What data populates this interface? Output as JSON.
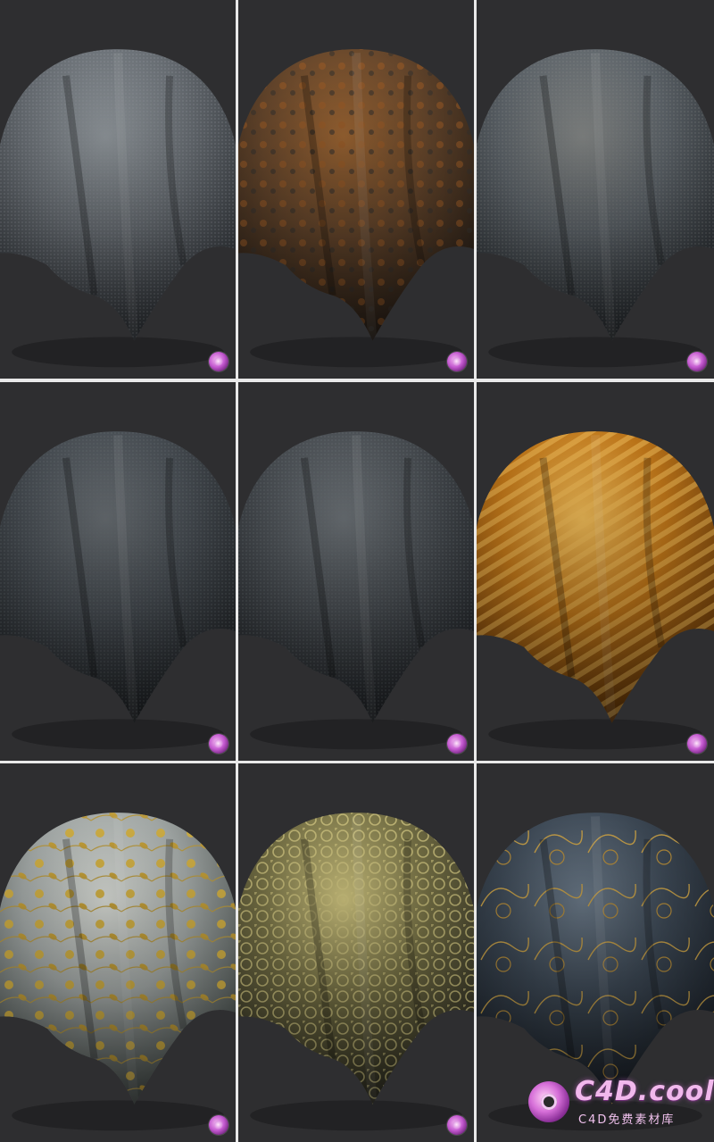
{
  "image": {
    "description_tags": [
      "fabric-material-grid"
    ],
    "swatches": [
      {
        "id": "denim-grey",
        "colors": {
          "base": "#6f757b",
          "shade": "#2c3035",
          "hi": "#9aa1a6"
        }
      },
      {
        "id": "rusted-fabric",
        "colors": {
          "base": "#6b4a2e",
          "shade": "#1f1a16",
          "hi": "#a46a35"
        }
      },
      {
        "id": "worn-grey",
        "colors": {
          "base": "#636a70",
          "shade": "#24282c",
          "hi": "#8c8f8e"
        }
      },
      {
        "id": "dark-felt",
        "colors": {
          "base": "#4a5056",
          "shade": "#1c1f22",
          "hi": "#6c7277"
        }
      },
      {
        "id": "charcoal-felt",
        "colors": {
          "base": "#4c5156",
          "shade": "#1d2024",
          "hi": "#70767b"
        }
      },
      {
        "id": "gold-ribbed",
        "colors": {
          "base": "#c77b1a",
          "shade": "#5a2f06",
          "hi": "#f7c15a"
        }
      },
      {
        "id": "floral-silk",
        "colors": {
          "base": "#aab0ae",
          "shade": "#3b4340",
          "hi": "#e0e3dd"
        }
      },
      {
        "id": "gold-lace",
        "colors": {
          "base": "#7a7548",
          "shade": "#262620",
          "hi": "#d7cc84"
        }
      },
      {
        "id": "dragon-silk",
        "colors": {
          "base": "#3f4b58",
          "shade": "#151a21",
          "hi": "#6e7d8c"
        }
      }
    ],
    "background_color": "#2e2e30",
    "separator_color": "#e9e9e9"
  },
  "watermark": {
    "title": "C4D.cool",
    "subtitle": "C4D免费素材库"
  }
}
